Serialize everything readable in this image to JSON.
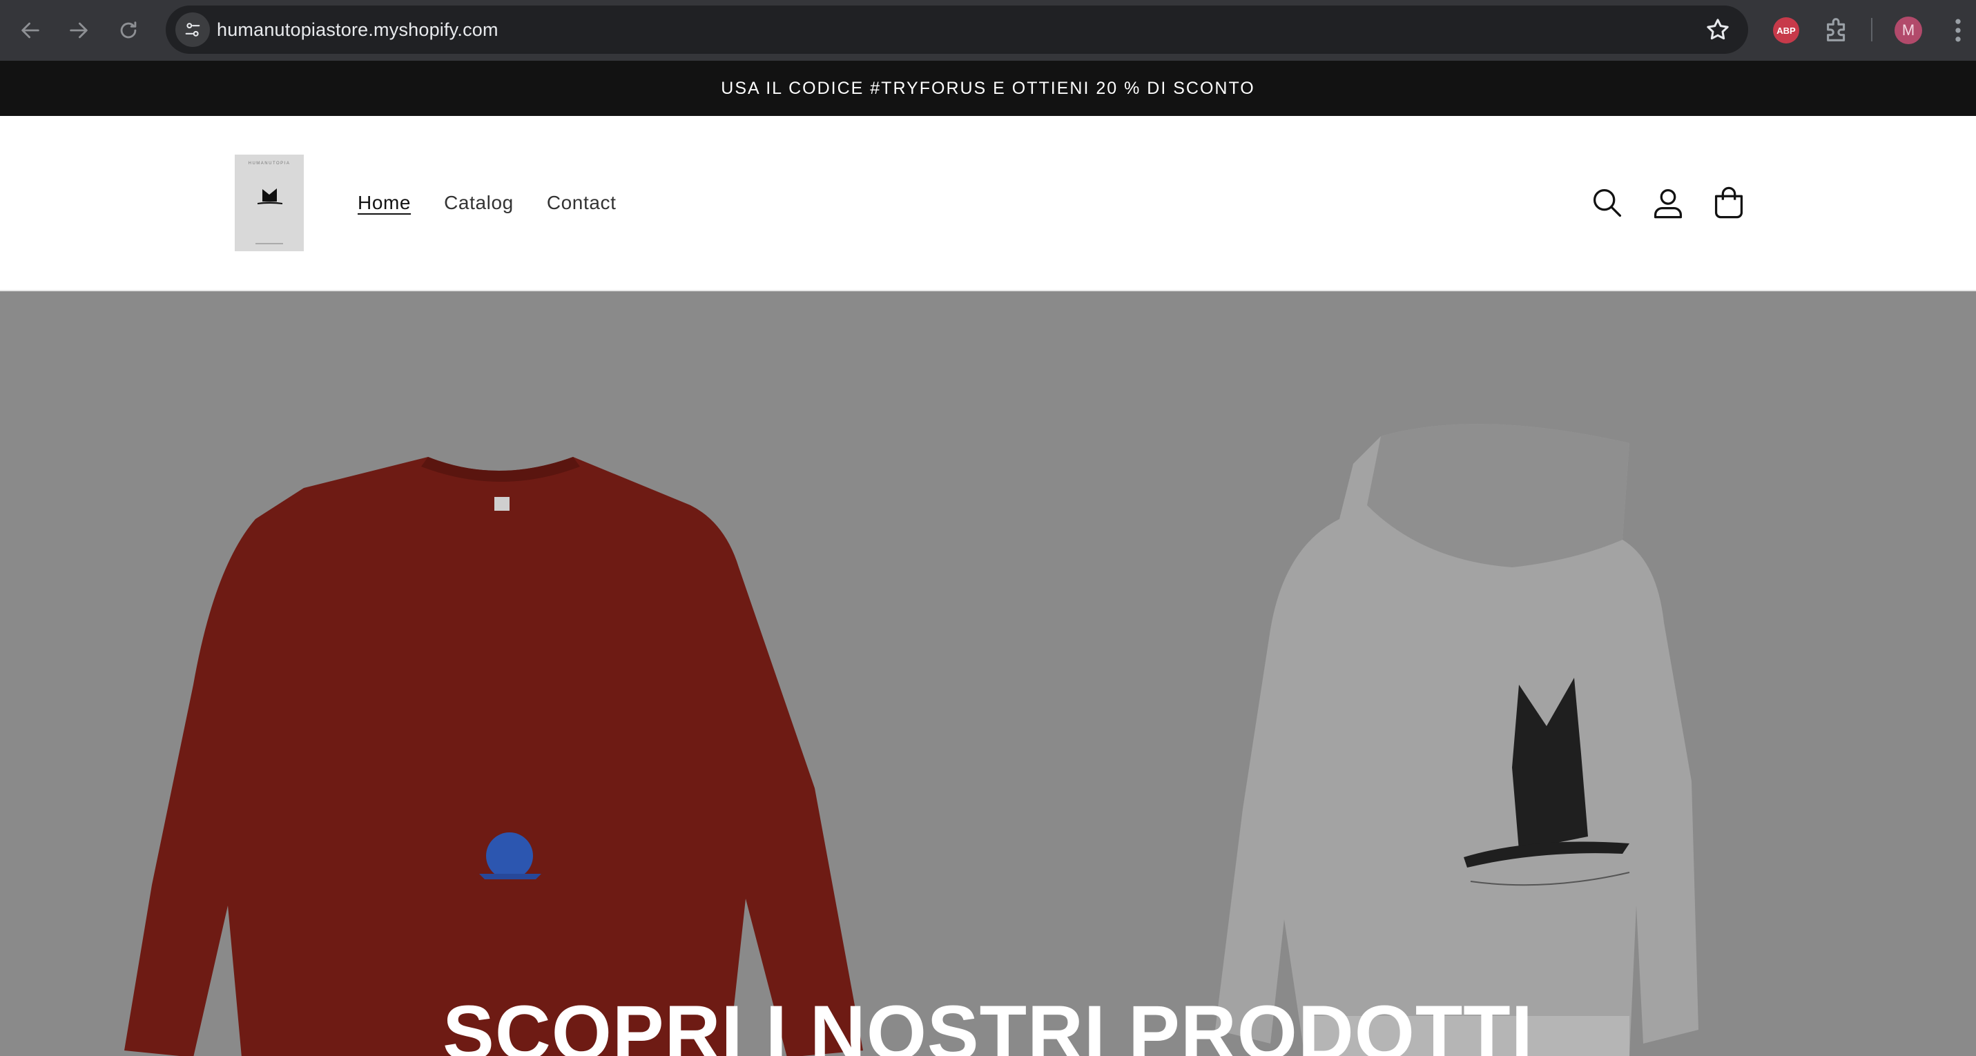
{
  "browser": {
    "url": "humanutopiastore.myshopify.com",
    "extension_abp": "ABP",
    "profile_initial": "M"
  },
  "announcement": {
    "text": "USA IL CODICE #TRYFORUS E OTTIENI 20 % DI SCONTO"
  },
  "header": {
    "logo_text": "HUMANUTOPIA",
    "nav": [
      {
        "label": "Home",
        "active": true
      },
      {
        "label": "Catalog",
        "active": false
      },
      {
        "label": "Contact",
        "active": false
      }
    ],
    "icons": [
      "search-icon",
      "account-icon",
      "cart-icon"
    ]
  },
  "hero": {
    "title": "SCOPRI I NOSTRI PRODOTTI",
    "background_color": "#8a8a8a"
  },
  "colors": {
    "announcement_bg": "#121212",
    "sweater": "#6e1b14",
    "hoodie": "#a3a3a3",
    "chrome_bg": "#35363a"
  }
}
